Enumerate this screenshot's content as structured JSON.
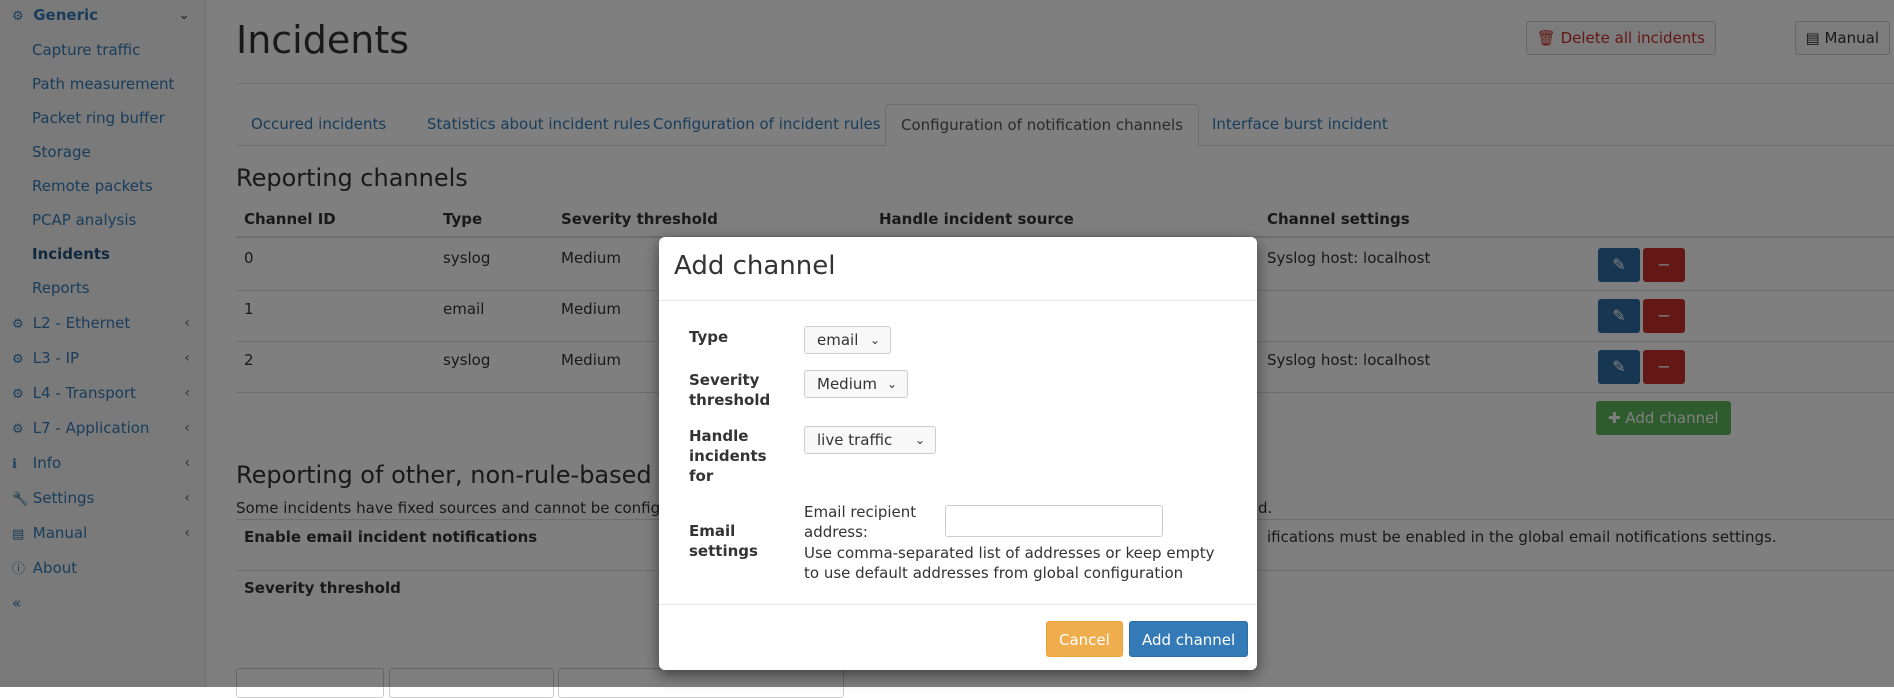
{
  "sidebar": {
    "generic_label": "Generic",
    "sub_items": [
      "Capture traffic",
      "Path measurement",
      "Packet ring buffer",
      "Storage",
      "Remote packets",
      "PCAP analysis",
      "Incidents",
      "Reports"
    ],
    "items": [
      "L2 - Ethernet",
      "L3 - IP",
      "L4 - Transport",
      "L7 - Application",
      "Info",
      "Settings",
      "Manual",
      "About"
    ],
    "collapse": "«"
  },
  "page": {
    "title": "Incidents",
    "delete_all": "Delete all incidents",
    "manual": "Manual"
  },
  "tabs": [
    "Occured incidents",
    "Statistics about incident rules",
    "Configuration of incident rules",
    "Configuration of notification channels",
    "Interface burst incident"
  ],
  "channels": {
    "title": "Reporting channels",
    "headers": [
      "Channel ID",
      "Type",
      "Severity threshold",
      "Handle incident source",
      "Channel settings"
    ],
    "rows": [
      {
        "id": "0",
        "type": "syslog",
        "severity": "Medium",
        "settings": "Syslog host: localhost"
      },
      {
        "id": "1",
        "type": "email",
        "severity": "Medium",
        "settings": ""
      },
      {
        "id": "2",
        "type": "syslog",
        "severity": "Medium",
        "settings": "Syslog host: localhost"
      }
    ],
    "add_label": "Add channel"
  },
  "other": {
    "title": "Reporting of other, non-rule-based",
    "desc_left": "Some incidents have fixed sources and cannot be configure",
    "desc_right": "d.",
    "enable_email": "Enable email incident notifications",
    "enable_note": "ifications must be enabled in the global email notifications settings.",
    "severity": "Severity threshold"
  },
  "modal": {
    "title": "Add channel",
    "type_label": "Type",
    "type_value": "email",
    "severity_label_1": "Severity",
    "severity_label_2": "threshold",
    "severity_value": "Medium",
    "handle_label_1": "Handle",
    "handle_label_2": "incidents",
    "handle_label_3": "for",
    "handle_value": "live traffic",
    "email_label_1": "Email",
    "email_label_2": "settings",
    "recipient_label_1": "Email recipient",
    "recipient_label_2": "address:",
    "recipient_value": "",
    "help_text": "Use comma-separated list of addresses or keep empty to use default addresses from global configuration",
    "cancel": "Cancel",
    "submit": "Add channel"
  }
}
